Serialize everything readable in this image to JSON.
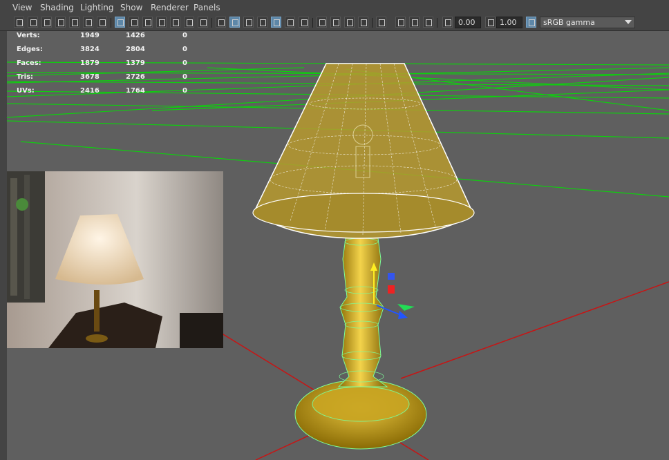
{
  "menu": [
    "View",
    "Shading",
    "Lighting",
    "Show",
    "Renderer",
    "Panels"
  ],
  "toolbar": {
    "exposure_value": "0.00",
    "gamma_value": "1.00",
    "color_space": "sRGB gamma"
  },
  "hud": {
    "rows": [
      {
        "label": "Verts:",
        "col1": "1949",
        "col2": "1426",
        "col3": "0"
      },
      {
        "label": "Edges:",
        "col1": "3824",
        "col2": "2804",
        "col3": "0"
      },
      {
        "label": "Faces:",
        "col1": "1879",
        "col2": "1379",
        "col3": "0"
      },
      {
        "label": "Tris:",
        "col1": "3678",
        "col2": "2726",
        "col3": "0"
      },
      {
        "label": "UVs:",
        "col1": "2416",
        "col2": "1764",
        "col3": "0"
      }
    ]
  },
  "icons": [
    "camera-icon",
    "bookmark-icon",
    "grid-icon",
    "wireframe-icon",
    "smooth-shade-icon",
    "texture-icon",
    "light-icon",
    "shadow-icon",
    "isolate-icon",
    "xray-icon",
    "exposure-icon",
    "gamma-icon",
    "color-management-icon"
  ],
  "colors": {
    "grid": "#00dd00",
    "axis_x": "#cc1111",
    "model": "#caa62a",
    "wire": "#ffffff",
    "selection": "#55ff88"
  }
}
